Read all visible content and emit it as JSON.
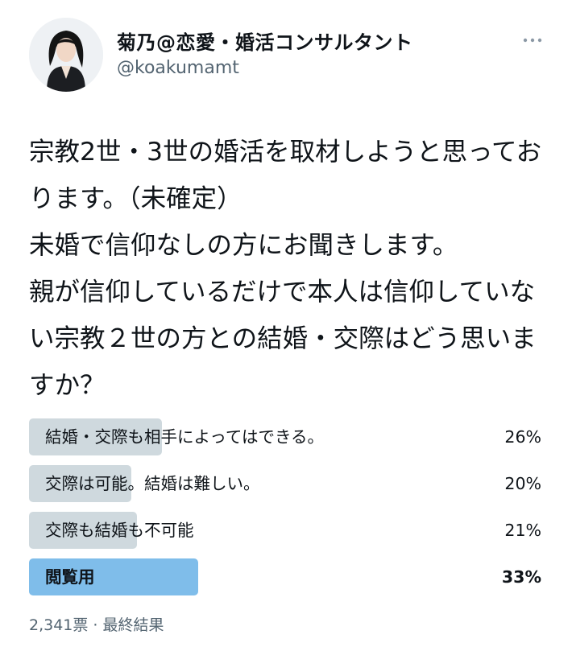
{
  "author": {
    "display_name": "菊乃@恋愛・婚活コンサルタント",
    "handle": "@koakumamt"
  },
  "tweet": {
    "text": "宗教2世・3世の婚活を取材しようと思っております。（未確定）\n未婚で信仰なしの方にお聞きします。\n親が信仰しているだけで本人は信仰していない宗教２世の方との結婚・交際はどう思いますか？"
  },
  "poll": {
    "options": [
      {
        "label": "結婚・交際も相手によってはできる。",
        "percent_text": "26%",
        "percent": 26,
        "winner": false
      },
      {
        "label": "交際は可能。結婚は難しい。",
        "percent_text": "20%",
        "percent": 20,
        "winner": false
      },
      {
        "label": "交際も結婚も不可能",
        "percent_text": "21%",
        "percent": 21,
        "winner": false
      },
      {
        "label": "閲覧用",
        "percent_text": "33%",
        "percent": 33,
        "winner": true
      }
    ],
    "meta": "2,341票 · 最終結果"
  },
  "colors": {
    "bar_default": "#cfd9de",
    "bar_winner": "#7fbdea",
    "secondary_text": "#536471"
  },
  "icons": [
    "avatar",
    "more-options-icon"
  ]
}
